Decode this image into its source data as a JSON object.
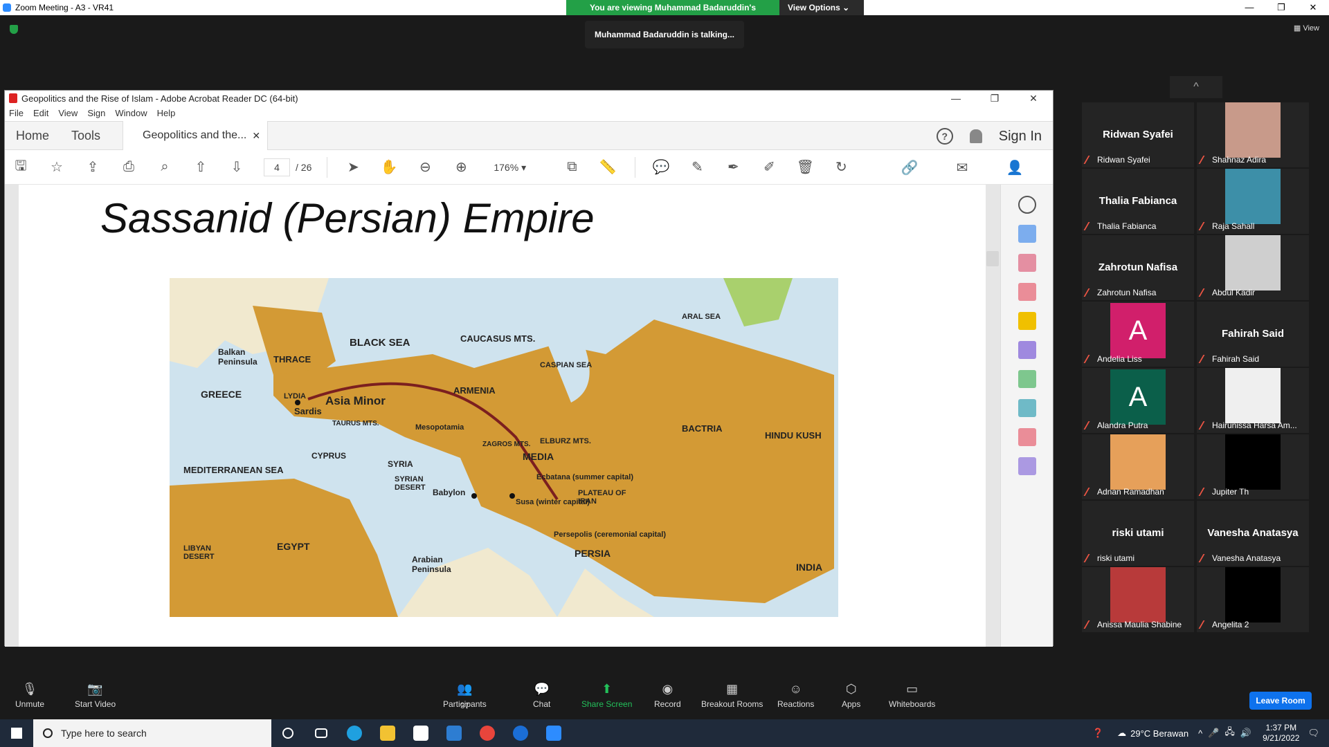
{
  "zoom": {
    "window_title": "Zoom Meeting - A3 - VR41",
    "viewing_banner": "You are viewing Muhammad Badaruddin's screen",
    "view_options": "View Options ⌄",
    "talking": "Muhammad Badaruddin is talking...",
    "view_label": "View",
    "window_controls": [
      "—",
      "❐",
      "✕"
    ]
  },
  "acrobat": {
    "window_title": "Geopolitics and the Rise of Islam - Adobe Acrobat Reader DC (64-bit)",
    "menu": [
      "File",
      "Edit",
      "View",
      "Sign",
      "Window",
      "Help"
    ],
    "tabs": {
      "home": "Home",
      "tools": "Tools",
      "doc": "Geopolitics and the...",
      "close": "✕"
    },
    "signin": "Sign In",
    "help": "?",
    "page_current": "4",
    "page_total": "/ 26",
    "zoom": "176%",
    "zoom_arrow": "▾",
    "window_controls": [
      "—",
      "❐",
      "✕"
    ]
  },
  "slide": {
    "title": "Sassanid (Persian) Empire",
    "map_labels": {
      "black_sea": "BLACK SEA",
      "caucasus": "CAUCASUS MTS.",
      "caspian": "CASPIAN SEA",
      "aral": "ARAL SEA",
      "balkan": "Balkan Peninsula",
      "thrace": "THRACE",
      "greece": "GREECE",
      "lydia": "LYDIA",
      "sardis": "Sardis",
      "asia_minor": "Asia Minor",
      "armenia": "ARMENIA",
      "elburz": "ELBURZ MTS.",
      "media": "MEDIA",
      "bactria": "BACTRIA",
      "hindu_kush": "HINDU KUSH",
      "cyprus": "CYPRUS",
      "syria": "SYRIA",
      "med_sea": "MEDITERRANEAN SEA",
      "syrian_desert": "SYRIAN DESERT",
      "babylon": "Babylon",
      "ecbatana": "Ecbatana (summer capital)",
      "susa": "Susa (winter capital)",
      "persepolis": "Persepolis (ceremonial capital)",
      "plateau": "PLATEAU OF IRAN",
      "persia": "PERSIA",
      "egypt": "EGYPT",
      "libyan": "LIBYAN DESERT",
      "arabian": "Arabian Peninsula",
      "india": "INDIA",
      "mesopotamia": "Mesopotamia",
      "zagros": "ZAGROS MTS.",
      "taurus": "TAURUS MTS."
    }
  },
  "participants": [
    {
      "name": "Ridwan Syafei",
      "tile_name": "Ridwan Syafei",
      "kind": "name"
    },
    {
      "name": "Shahnaz Adira",
      "kind": "photo",
      "color": "#c89a8a"
    },
    {
      "name": "Thalia Fabianca",
      "tile_name": "Thalia Fabianca",
      "kind": "name"
    },
    {
      "name": "Raja Sahall",
      "kind": "photo",
      "color": "#3d8fa8"
    },
    {
      "name": "Zahrotun Nafisa",
      "tile_name": "Zahrotun Nafisa",
      "kind": "name"
    },
    {
      "name": "Abdul Kadir",
      "kind": "photo",
      "color": "#cfcfcf"
    },
    {
      "name": "Andelia Liss",
      "letter": "A",
      "kind": "letter",
      "color": "#d11f6b"
    },
    {
      "name": "Fahirah Said",
      "tile_name": "Fahirah Said",
      "kind": "name"
    },
    {
      "name": "Alandra Putra",
      "letter": "A",
      "kind": "letter",
      "color": "#0b5f4a"
    },
    {
      "name": "Hairunissa Harsa Am...",
      "kind": "photo",
      "color": "#efefef"
    },
    {
      "name": "Adnan Ramadhan",
      "kind": "photo",
      "color": "#e6a05a"
    },
    {
      "name": "Jupiter Th",
      "kind": "photo",
      "color": "#000000"
    },
    {
      "name": "riski utami",
      "tile_name": "riski utami",
      "kind": "name"
    },
    {
      "name": "Vanesha Anatasya",
      "tile_name": "Vanesha Anatasya",
      "kind": "name"
    },
    {
      "name": "Anissa Maulia Shabine",
      "kind": "photo",
      "color": "#b83a3a"
    },
    {
      "name": "Angelita 2",
      "kind": "photo",
      "color": "#000000"
    }
  ],
  "collapse_icon": "^",
  "bottom_bar": {
    "unmute": "Unmute",
    "start_video": "Start Video",
    "participants": "Participants",
    "participants_count": "37",
    "chat": "Chat",
    "share_screen": "Share Screen",
    "record": "Record",
    "breakout": "Breakout Rooms",
    "reactions": "Reactions",
    "apps": "Apps",
    "whiteboards": "Whiteboards",
    "leave": "Leave Room"
  },
  "taskbar": {
    "search_placeholder": "Type here to search",
    "weather": "29°C  Berawan",
    "time": "1:37 PM",
    "date": "9/21/2022"
  },
  "colors": {
    "zoom_green": "#23a047",
    "zoom_blue": "#0e72ed",
    "land": "#d39a35",
    "sea": "#cfe3ee"
  }
}
